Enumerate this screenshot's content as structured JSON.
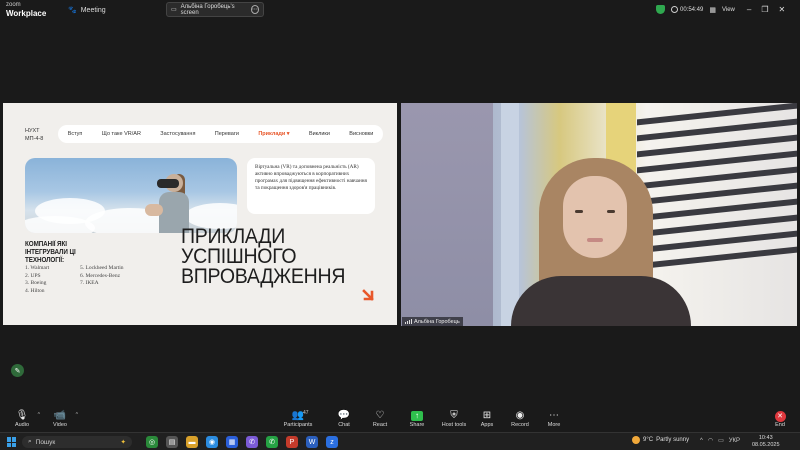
{
  "topbar": {
    "logo_line1": "zoom",
    "logo_line2": "Workplace",
    "meeting_label": "Meeting",
    "share_label": "Альбіна Горобець's screen",
    "timer": "00:54:49",
    "view_label": "View",
    "security_color": "#2fa84f"
  },
  "slide": {
    "org": "НУХТ МП-4-8",
    "nav": [
      "Вступ",
      "Що таке VR/AR",
      "Застосування",
      "Переваги",
      "Приклади",
      "Виклики",
      "Висновки"
    ],
    "nav_active": "Приклади",
    "accent_color": "#e8572a",
    "intro_text": "Віртуальна (VR) та доповнена реальність (AR) активно впроваджуються в корпоративних програмах для підвищення ефективності навчання та покращення здоров'я працівників.",
    "companies_title": "КОМПАНІЇ ЯКІ ІНТЕГРУВАЛИ ЦІ ТЕХНОЛОГІЇ:",
    "companies_col1": [
      "1. Walmart",
      "2. UPS",
      "3. Boeing",
      "4. Hilton"
    ],
    "companies_col2": [
      "5. Lockheed Martin",
      "6. Mercedes-Benz",
      "7. IKEA"
    ],
    "headline": [
      "ПРИКЛАДИ",
      "УСПІШНОГО",
      "ВПРОВАДЖЕННЯ"
    ]
  },
  "camera": {
    "name_label": "Альбіна Горобець"
  },
  "toolbar": {
    "audio": "Audio",
    "video": "Video",
    "participants": "Participants",
    "participants_count": "47",
    "chat": "Chat",
    "react": "React",
    "share": "Share",
    "host_tools": "Host tools",
    "apps": "Apps",
    "record": "Record",
    "more": "More",
    "end": "End"
  },
  "taskbar": {
    "search_placeholder": "Пошук",
    "weather_temp": "9°C",
    "weather_text": "Partly sunny",
    "language": "УКР",
    "time": "10:43",
    "date": "08.05.2025"
  }
}
